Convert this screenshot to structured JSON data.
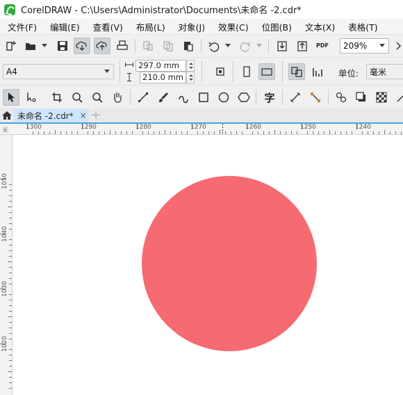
{
  "window": {
    "title": "CorelDRAW - C:\\Users\\Administrator\\Documents\\未命名 -2.cdr*"
  },
  "menu": [
    "文件(F)",
    "编辑(E)",
    "查看(V)",
    "布局(L)",
    "对象(J)",
    "效果(C)",
    "位图(B)",
    "文本(X)",
    "表格(T)"
  ],
  "standard_toolbar": {
    "zoom_value": "209%",
    "pdf_label": "PDF"
  },
  "property_bar": {
    "page_size": "A4",
    "width": "297.0 mm",
    "height": "210.0 mm",
    "units_label": "单位:",
    "units_value": "毫米"
  },
  "toolbox": {
    "text_tool_glyph": "字"
  },
  "document_tab": {
    "name": "未命名 -2.cdr*",
    "close": "×",
    "add": "+"
  },
  "rulers": {
    "horizontal_ticks": [
      "1300",
      "1290",
      "1280",
      "1270",
      "1260",
      "1250",
      "1240"
    ],
    "vertical_ticks": [
      "1050",
      "1040",
      "1030",
      "1020"
    ],
    "corner": "米"
  },
  "canvas": {
    "shape": "circle",
    "fill_color": "#f66b72"
  }
}
